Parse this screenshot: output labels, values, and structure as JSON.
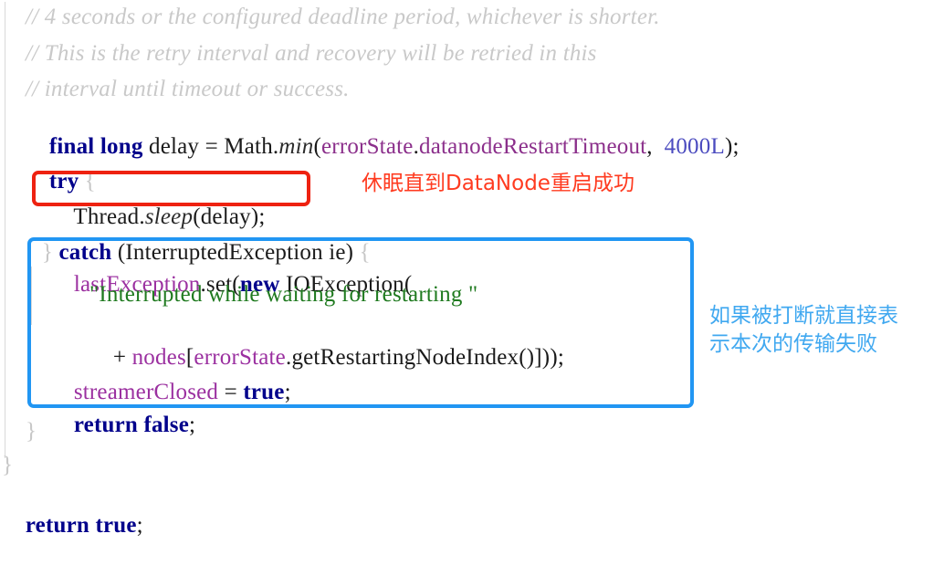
{
  "document": {
    "kind": "java-source-snippet-with-annotations",
    "background_color": "#ffffff"
  },
  "colors": {
    "comment": "#c9c9c9",
    "keyword": "#00008b",
    "string": "#1f7a1f",
    "field": "#8b2f8b",
    "number": "#4b4bbf",
    "plain": "#1a1a1a",
    "brace": "#c7c7c7",
    "box_red": "#ee2211",
    "box_blue": "#2196f3",
    "annotation_red": "#ff3b20",
    "annotation_blue": "#40a8f0"
  },
  "code": {
    "line1_comment": "// 4 seconds or the configured deadline period, whichever is shorter.",
    "line2_comment": "// This is the retry interval and recovery will be retried in this",
    "line3_comment": "// interval until timeout or success.",
    "line4": {
      "kw_final": "final",
      "space1": " ",
      "kw_long": "long",
      "mid": " delay = Math.",
      "method_min": "min",
      "paren_open": "(",
      "field_errorstate": "errorState",
      "dot": ".",
      "field_timeout": "datanodeRestartTimeout",
      "comma": ",  ",
      "num_4000": "4000L",
      "tail": ");"
    },
    "line5": {
      "kw_try": "try",
      "brace": " {"
    },
    "line6_boxed": {
      "thread": "Thread.",
      "sleep": "sleep",
      "args": "(delay);"
    },
    "line7": {
      "brace_close": "}",
      "kw_catch": " catch",
      "rest": " (InterruptedException ie) ",
      "brace_open": "{"
    },
    "line8_boxed": {
      "field_lastexception": "lastException",
      "dot_set": ".set(",
      "kw_new": "new",
      "rest": " IOException("
    },
    "line9_boxed": {
      "string": "\"Interrupted while waiting for restarting \""
    },
    "line10_boxed": {
      "plus": "+ ",
      "nodes": "nodes",
      "bracket": "[",
      "errorstate": "errorState",
      "dot": ".",
      "call": "getRestartingNodeIndex()",
      "tail": "]));"
    },
    "line11_boxed": {
      "field_streamerclosed": "streamerClosed",
      "eq": " = ",
      "kw_true": "true",
      "semi": ";"
    },
    "line12_boxed": {
      "kw_return": "return",
      "space": " ",
      "kw_false": "false",
      "semi": ";"
    },
    "line13": "}",
    "line14": "}",
    "line15": {
      "kw_return": "return",
      "space": " ",
      "kw_true": "true",
      "semi": ";"
    }
  },
  "annotations": {
    "red_note": "休眠直到DataNode重启成功",
    "blue_note_line1": "如果被打断就直接表",
    "blue_note_line2": "示本次的传输失败"
  }
}
